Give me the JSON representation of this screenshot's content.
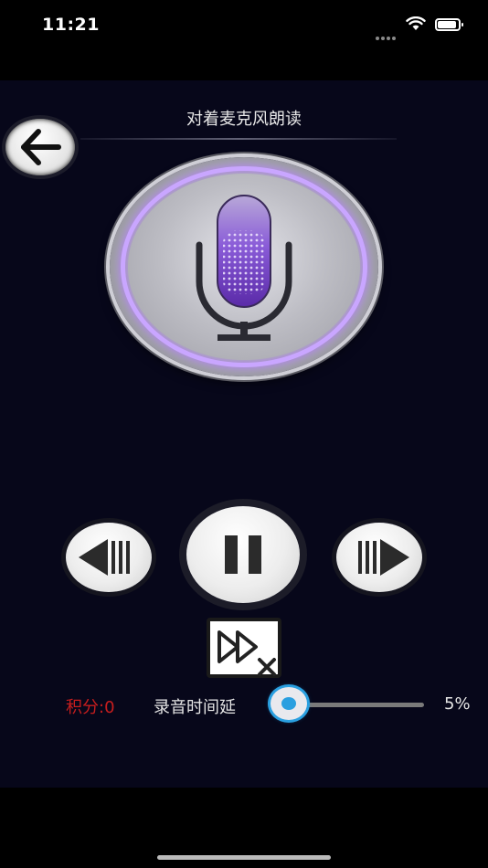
{
  "status_bar": {
    "time": "11:21"
  },
  "header": {
    "title": "对着麦克风朗读"
  },
  "score": {
    "label": "积分:0"
  },
  "recording_delay": {
    "label": "录音时间延",
    "value_text": "5%",
    "level": 0.05
  },
  "colors": {
    "background": "#07071a",
    "accent": "#2a9fe0",
    "score_text": "#c81e1e",
    "mic_glow": "#c9a6ff"
  },
  "icons": {
    "back": "arrow-left-icon",
    "mic": "microphone-icon",
    "prev": "previous-icon",
    "pause": "pause-icon",
    "next": "next-icon",
    "skip": "skip-off-icon"
  }
}
